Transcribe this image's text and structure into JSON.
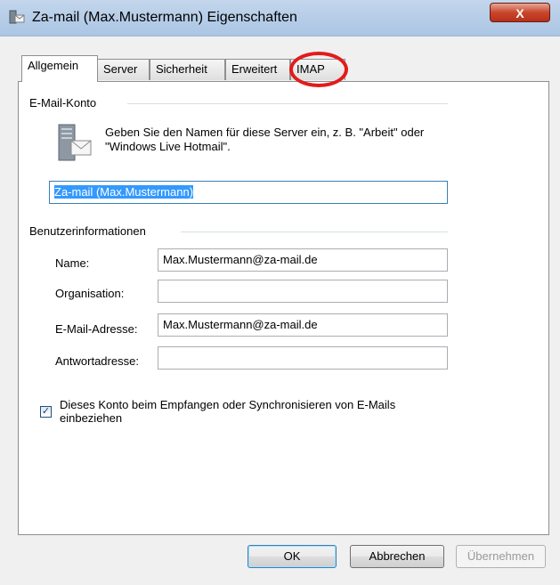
{
  "window": {
    "title": "Za-mail (Max.Mustermann) Eigenschaften",
    "close_glyph": "X"
  },
  "tabs": [
    {
      "label": "Allgemein"
    },
    {
      "label": "Server"
    },
    {
      "label": "Sicherheit"
    },
    {
      "label": "Erweitert"
    },
    {
      "label": "IMAP"
    }
  ],
  "email_account": {
    "group_label": "E-Mail-Konto",
    "description": "Geben Sie den Namen für diese Server ein, z. B. \"Arbeit\" oder \"Windows Live Hotmail\".",
    "account_name": "Za-mail (Max.Mustermann)"
  },
  "user_info": {
    "group_label": "Benutzerinformationen",
    "name_label": "Name:",
    "name_value": "Max.Mustermann@za-mail.de",
    "org_label": "Organisation:",
    "org_value": "",
    "email_label": "E-Mail-Adresse:",
    "email_value": "Max.Mustermann@za-mail.de",
    "reply_label": "Antwortadresse:",
    "reply_value": ""
  },
  "include_checkbox": {
    "checked": true,
    "label": "Dieses Konto beim Empfangen oder Synchronisieren von E-Mails einbeziehen"
  },
  "buttons": {
    "ok": "OK",
    "cancel": "Abbrechen",
    "apply": "Übernehmen"
  },
  "colors": {
    "highlight_ring": "#e31b1b",
    "selection": "#3399ff",
    "titlebar": "#b7cde8"
  },
  "icons": {
    "title": "mail-account-icon",
    "account": "mail-server-icon"
  }
}
